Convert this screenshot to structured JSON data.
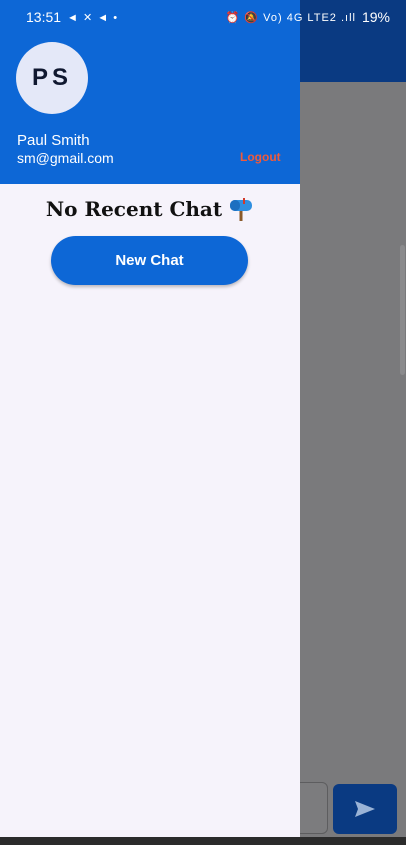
{
  "status_bar": {
    "time": "13:51",
    "left_icons": "◄ ✕ ◄ •",
    "right_icons": "⏰ 🔕 Vo) 4G LTE2 .ıll",
    "battery": "19%"
  },
  "drawer": {
    "avatar_initials": "PS",
    "user_name": "Paul Smith",
    "user_email": "sm@gmail.com",
    "logout_label": "Logout",
    "empty_message": "No Recent Chat",
    "empty_icon": "mailbox-icon",
    "new_chat_label": "New Chat"
  },
  "colors": {
    "primary": "#0d67d6",
    "dark_primary": "#0a3a82",
    "logout": "#f05a3a",
    "drawer_bg": "#f6f3fb",
    "scrim": "#7a7a7c"
  }
}
